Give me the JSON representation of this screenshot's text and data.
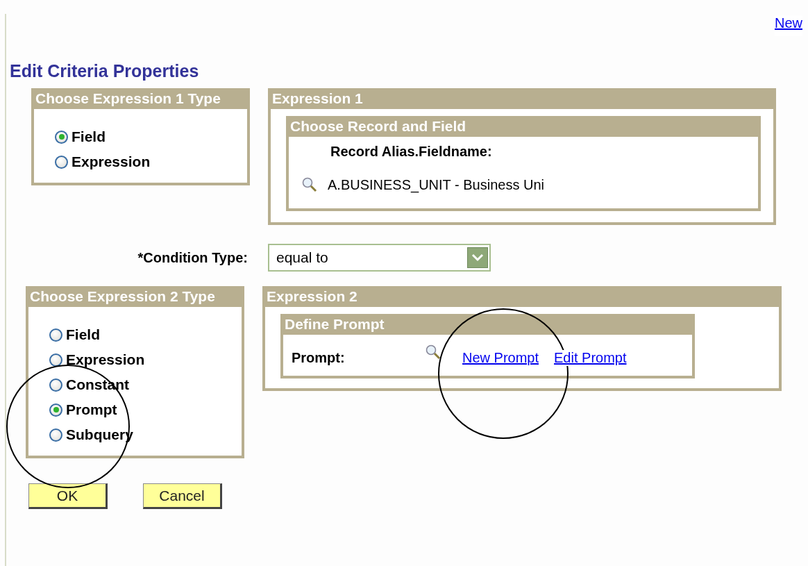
{
  "top_link": "New",
  "title": "Edit Criteria Properties",
  "expr1_type": {
    "title": "Choose Expression 1 Type",
    "options": [
      {
        "label": "Field",
        "selected": true
      },
      {
        "label": "Expression",
        "selected": false
      }
    ]
  },
  "expr1": {
    "title": "Expression 1",
    "group": {
      "title": "Choose Record and Field",
      "label": "Record Alias.Fieldname:",
      "value": "A.BUSINESS_UNIT - Business Uni"
    }
  },
  "condition": {
    "label": "*Condition Type:",
    "value": "equal to"
  },
  "expr2_type": {
    "title": "Choose Expression 2 Type",
    "options": [
      {
        "label": "Field",
        "selected": false
      },
      {
        "label": "Expression",
        "selected": false
      },
      {
        "label": "Constant",
        "selected": false
      },
      {
        "label": "Prompt",
        "selected": true
      },
      {
        "label": "Subquery",
        "selected": false
      }
    ]
  },
  "expr2": {
    "title": "Expression 2",
    "group": {
      "title": "Define Prompt",
      "label": "Prompt:",
      "links": [
        "New Prompt",
        "Edit Prompt"
      ]
    }
  },
  "buttons": [
    "OK",
    "Cancel"
  ]
}
